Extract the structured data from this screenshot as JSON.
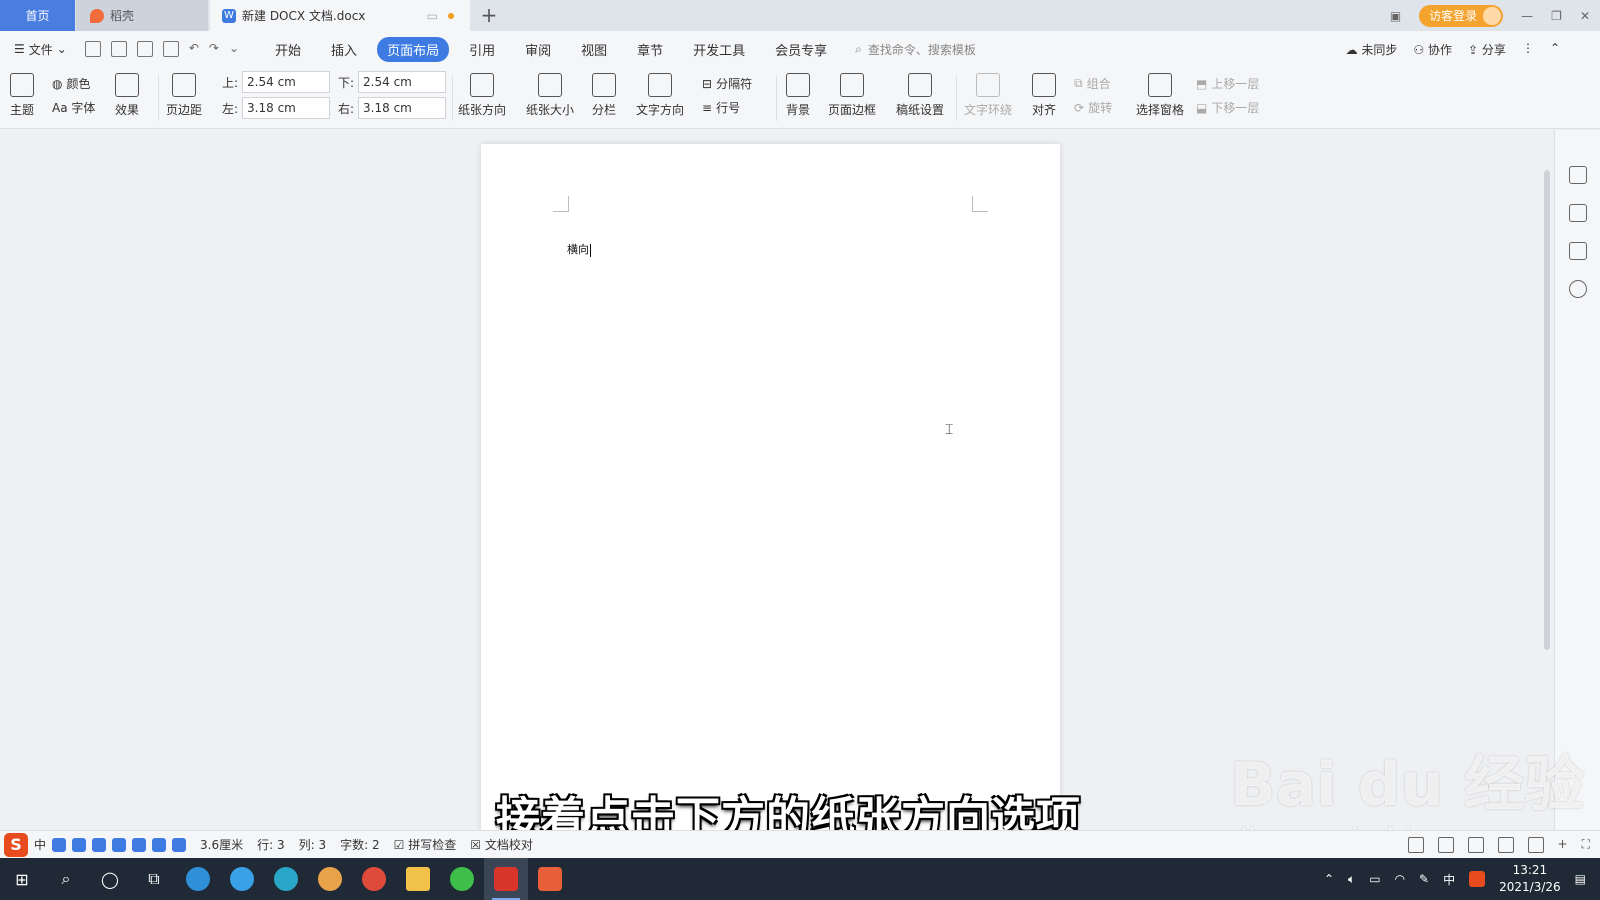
{
  "tabs": {
    "home": "首页",
    "daoke": "稻壳",
    "doc": "新建 DOCX 文档.docx",
    "new_tab": "+",
    "guest_login": "访客登录"
  },
  "menubar": {
    "file": "文件",
    "tabs": [
      "开始",
      "插入",
      "页面布局",
      "引用",
      "审阅",
      "视图",
      "章节",
      "开发工具",
      "会员专享"
    ],
    "active_tab": "页面布局",
    "search_placeholder": "查找命令、搜索模板",
    "right": [
      "未同步",
      "协作",
      "分享"
    ]
  },
  "ribbon": {
    "theme": "主题",
    "color": "颜色",
    "font": "Aa 字体",
    "effect": "效果",
    "margins": "页边距",
    "top_label": "上:",
    "top_value": "2.54 cm",
    "bottom_label": "下:",
    "bottom_value": "2.54 cm",
    "left_label": "左:",
    "left_value": "3.18 cm",
    "right_label": "右:",
    "right_value": "3.18 cm",
    "orientation": "纸张方向",
    "size": "纸张大小",
    "columns": "分栏",
    "text_direction": "文字方向",
    "separator": "分隔符",
    "line_numbers": "行号",
    "background": "背景",
    "page_border": "页面边框",
    "manuscript": "稿纸设置",
    "wrap": "文字环绕",
    "align": "对齐",
    "group": "组合",
    "rotate": "旋转",
    "selection_pane": "选择窗格",
    "bring_forward": "上移一层",
    "send_backward": "下移一层"
  },
  "document": {
    "text": "横向"
  },
  "subtitle": "接着点击下方的纸张方向选项",
  "watermark": {
    "brand": "Bai du 经验",
    "url": "jingyan.baidu.com"
  },
  "statusbar": {
    "ime_logo": "S",
    "ime_lang": "中",
    "position": "3.6厘米",
    "row": "行: 3",
    "col": "列: 3",
    "word_count": "字数: 2",
    "spell_check": "拼写检查",
    "doc_proof": "文档校对"
  },
  "taskbar": {
    "tray_lang": "中",
    "time": "13:21",
    "date": "2021/3/26"
  }
}
